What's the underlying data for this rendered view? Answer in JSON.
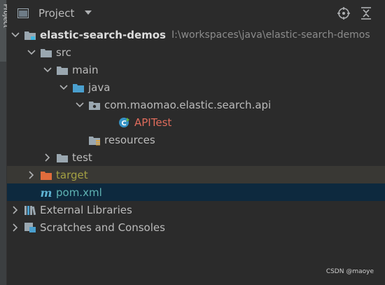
{
  "side_tab": {
    "label": "Project"
  },
  "header": {
    "title": "Project",
    "dropdown_icon": "caret-down-icon",
    "locate_icon": "crosshair-icon",
    "collapse_icon": "collapse-all-icon"
  },
  "tree": {
    "root": {
      "name": "elastic-search-demos",
      "path": "I:\\workspaces\\java\\elastic-search-demos"
    },
    "src": "src",
    "main": "main",
    "java": "java",
    "package": "com.maomao.elastic.search.api",
    "class": "APITest",
    "resources": "resources",
    "test": "test",
    "target": "target",
    "pom": "pom.xml",
    "ext_libs": "External Libraries",
    "scratches": "Scratches and Consoles"
  },
  "watermark": "CSDN @maoye",
  "colors": {
    "selection": "#0d293e",
    "excluded": "#a4a043",
    "error": "#e06c5c"
  }
}
